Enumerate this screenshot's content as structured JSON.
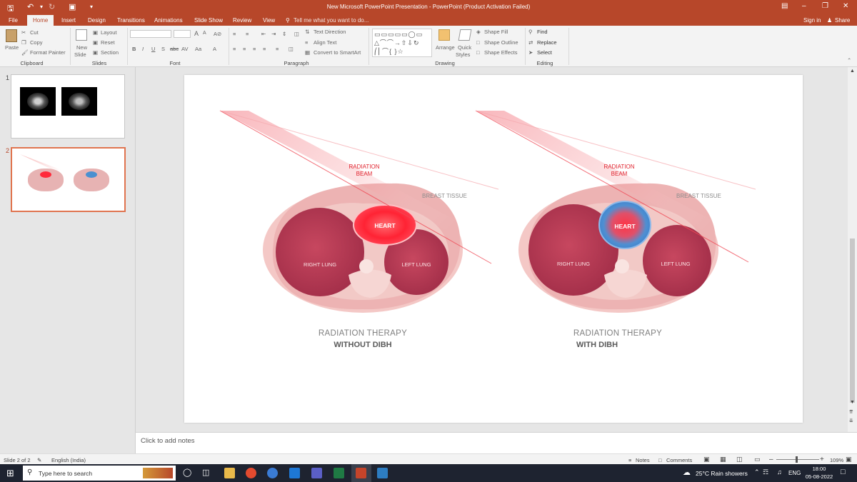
{
  "app": {
    "window_title": "New Microsoft PowerPoint Presentation - PowerPoint (Product Activation Failed)",
    "sign_in": "Sign in",
    "share": "Share"
  },
  "tabs": [
    "File",
    "Home",
    "Insert",
    "Design",
    "Transitions",
    "Animations",
    "Slide Show",
    "Review",
    "View"
  ],
  "tell_me": "Tell me what you want to do...",
  "ribbon": {
    "clipboard": {
      "paste": "Paste",
      "cut": "Cut",
      "copy": "Copy",
      "format_painter": "Format Painter",
      "label": "Clipboard"
    },
    "slides": {
      "new_slide_1": "New",
      "new_slide_2": "Slide",
      "layout": "Layout",
      "reset": "Reset",
      "section": "Section",
      "label": "Slides"
    },
    "font": {
      "label": "Font"
    },
    "paragraph": {
      "text_direction": "Text Direction",
      "align_text": "Align Text",
      "convert_smartart": "Convert to SmartArt",
      "label": "Paragraph"
    },
    "drawing": {
      "arrange": "Arrange",
      "quick_styles_1": "Quick",
      "quick_styles_2": "Styles",
      "shape_fill": "Shape Fill",
      "shape_outline": "Shape Outline",
      "shape_effects": "Shape Effects",
      "label": "Drawing"
    },
    "editing": {
      "find": "Find",
      "replace": "Replace",
      "select": "Select",
      "label": "Editing"
    }
  },
  "thumbnails": [
    {
      "number": "1",
      "selected": false
    },
    {
      "number": "2",
      "selected": true
    }
  ],
  "slide": {
    "left_panel": {
      "beam_label_1": "RADIATION",
      "beam_label_2": "BEAM",
      "breast_tissue": "BREAST TISSUE",
      "heart": "HEART",
      "right_lung": "RIGHT LUNG",
      "left_lung": "LEFT LUNG",
      "caption_line1": "RADIATION THERAPY",
      "caption_line2": "WITHOUT DIBH",
      "heart_color": "#ff2a3a"
    },
    "right_panel": {
      "beam_label_1": "RADIATION",
      "beam_label_2": "BEAM",
      "breast_tissue": "BREAST TISSUE",
      "heart": "HEART",
      "right_lung": "RIGHT LUNG",
      "left_lung": "LEFT LUNG",
      "caption_line1": "RADIATION THERAPY",
      "caption_line2": "WITH DIBH",
      "heart_color": "#3d8fd6"
    }
  },
  "notes_placeholder": "Click to add notes",
  "status": {
    "slide_count": "Slide 2 of 2",
    "language": "English (India)",
    "notes": "Notes",
    "comments": "Comments",
    "zoom": "109%"
  },
  "taskbar": {
    "search_placeholder": "Type here to search",
    "weather": "25°C  Rain showers",
    "language": "ENG",
    "time": "18:00",
    "date": "05-08-2022"
  },
  "colors": {
    "accent": "#b7472a",
    "taskbar": "#1e2330"
  }
}
